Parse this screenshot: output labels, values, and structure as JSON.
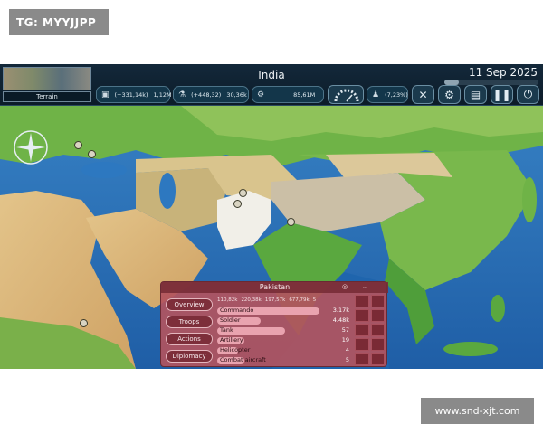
{
  "watermarks": {
    "top": "TG: MYYJJPP",
    "bottom": "www.snd-xjt.com"
  },
  "topbar": {
    "terrain_label": "Terrain",
    "country": "India",
    "date": "11 Sep 2025",
    "speed_fraction": 0.15,
    "stats": {
      "a": "(+331,14k)",
      "b": "1,12M",
      "c": "(+448,32)",
      "d": "30,36k",
      "e": "85,61M",
      "f": "(7,23%)"
    }
  },
  "icons": {
    "money": "money-icon",
    "science": "flask-icon",
    "population": "population-icon",
    "gauge": "gauge-icon",
    "approval": "approval-icon",
    "tools": "tools-icon",
    "settings": "gear-icon",
    "save": "save-icon",
    "pause": "pause-icon",
    "power": "power-icon"
  },
  "panel": {
    "title": "Pakistan",
    "menu": {
      "overview": "Overview",
      "troops": "Troops",
      "actions": "Actions",
      "diplomacy": "Diplomacy"
    },
    "resources": {
      "r1": "110,82k",
      "r2": "220,38k",
      "r3": "197,57k",
      "r4": "677,79k",
      "r5": "5"
    },
    "units": [
      {
        "name": "Commando",
        "value": "3.17k",
        "fill": 0.75
      },
      {
        "name": "Soldier",
        "value": "4.48k",
        "fill": 0.32
      },
      {
        "name": "Tank",
        "value": "57",
        "fill": 0.5
      },
      {
        "name": "Artillery",
        "value": "19",
        "fill": 0.2
      },
      {
        "name": "Helicopter",
        "value": "4",
        "fill": 0.15
      },
      {
        "name": "Combat aircraft",
        "value": "5",
        "fill": 0.2
      }
    ]
  },
  "colors": {
    "panel": "#b2545e",
    "topbar": "#13283a",
    "ocean": "#2f6fb4",
    "land": "#5aa83f"
  }
}
